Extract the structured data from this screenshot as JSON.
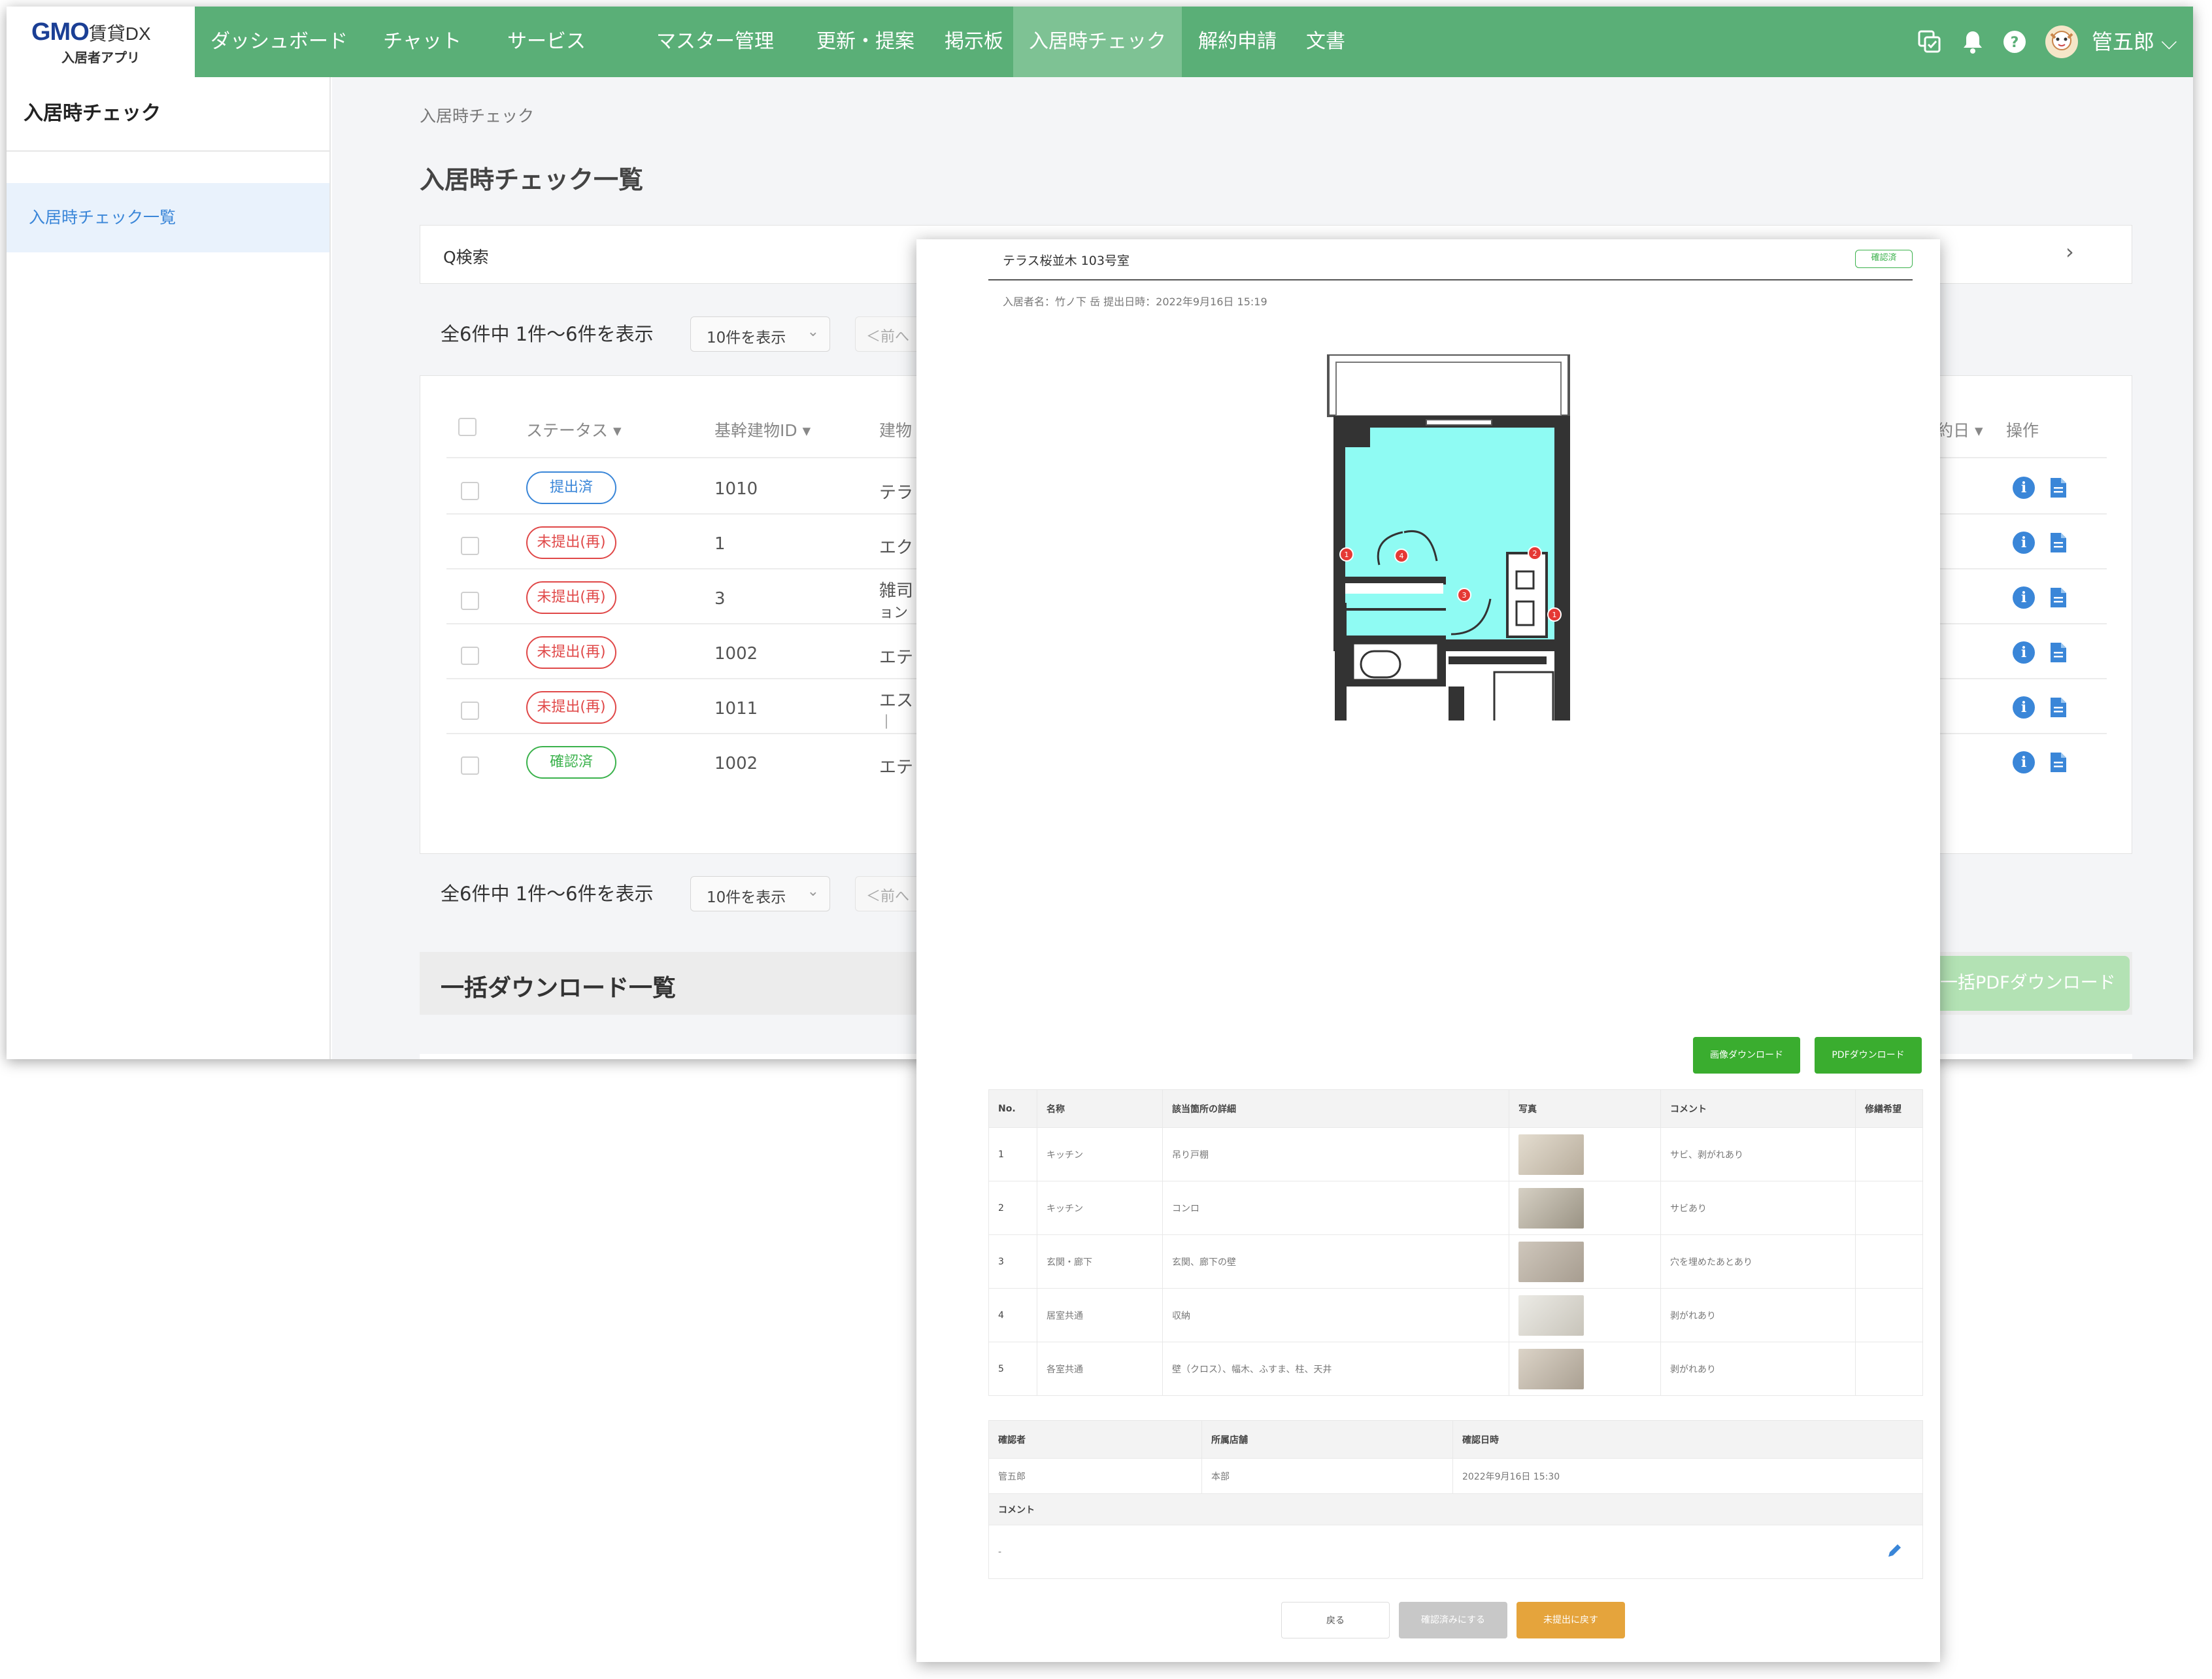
{
  "header": {
    "logo_text": "GMO",
    "logo_brand": "賃貸DX",
    "logo_sub": "入居者アプリ",
    "nav": [
      "ダッシュボード",
      "チャット",
      "サービス",
      "マスター管理",
      "更新・提案",
      "掲示板",
      "入居時チェック",
      "解約申請",
      "文書"
    ],
    "active_nav": "入居時チェック",
    "icons": [
      "copy-check-icon",
      "bell-icon",
      "help-icon"
    ],
    "user_name": "管五郎",
    "user_chevron": "⌵"
  },
  "sidebar": {
    "title": "入居時チェック",
    "items": [
      {
        "label": "入居時チェック一覧",
        "selected": true
      }
    ]
  },
  "main": {
    "breadcrumb": "入居時チェック",
    "page_title": "入居時チェック一覧",
    "search_label": "Q検索",
    "search_chevron": "›",
    "pagination": {
      "summary": "全6件中 1件〜6件を表示",
      "per_page": "10件を表示",
      "prev": "＜前へ"
    },
    "table": {
      "headers": {
        "status": "ステータス ▾",
        "building_id": "基幹建物ID ▾",
        "building": "建物",
        "date": "約日 ▾",
        "actions": "操作"
      },
      "rows": [
        {
          "status": "提出済",
          "tone": "blue",
          "building_id": "1010",
          "building": "テラ",
          "building2": ""
        },
        {
          "status": "未提出(再)",
          "tone": "red",
          "building_id": "1",
          "building": "エク",
          "building2": ""
        },
        {
          "status": "未提出(再)",
          "tone": "red",
          "building_id": "3",
          "building": "雑司",
          "building2": "ョン"
        },
        {
          "status": "未提出(再)",
          "tone": "red",
          "building_id": "1002",
          "building": "エテ",
          "building2": ""
        },
        {
          "status": "未提出(再)",
          "tone": "red",
          "building_id": "1011",
          "building": "エス",
          "building2": "｜"
        },
        {
          "status": "確認済",
          "tone": "green",
          "building_id": "1002",
          "building": "エテ",
          "building2": ""
        }
      ]
    },
    "bulk_title": "一括ダウンロード一覧",
    "bulk_button": "一括PDFダウンロード"
  },
  "modal": {
    "title": "テラス桜並木 103号室",
    "badge": "確認済",
    "meta": "入居者名：竹ノ下 岳 提出日時：2022年9月16日 15:19",
    "image_download": "画像ダウンロード",
    "pdf_download": "PDFダウンロード",
    "table_headers": [
      "No.",
      "名称",
      "該当箇所の詳細",
      "写真",
      "コメント",
      "修繕希望"
    ],
    "items": [
      {
        "no": "1",
        "name": "キッチン",
        "detail": "吊り戸棚",
        "comment": "サビ、剥がれあり",
        "repair": ""
      },
      {
        "no": "2",
        "name": "キッチン",
        "detail": "コンロ",
        "comment": "サビあり",
        "repair": ""
      },
      {
        "no": "3",
        "name": "玄関・廊下",
        "detail": "玄関、廊下の壁",
        "comment": "穴を埋めたあとあり",
        "repair": ""
      },
      {
        "no": "4",
        "name": "居室共通",
        "detail": "収納",
        "comment": "剥がれあり",
        "repair": ""
      },
      {
        "no": "5",
        "name": "各室共通",
        "detail": "壁（クロス）、幅木、ふすま、柱、天井",
        "comment": "剥がれあり",
        "repair": ""
      }
    ],
    "confirm_headers": [
      "確認者",
      "所属店舗",
      "確認日時"
    ],
    "confirm_values": [
      "管五郎",
      "本部",
      "2022年9月16日 15:30"
    ],
    "comment_label": "コメント",
    "comment_value": "-",
    "buttons": {
      "back": "戻る",
      "confirm": "確認済みにする",
      "revert": "未提出に戻す"
    },
    "colors": {
      "room_fill": "#8ffbf3",
      "marker": "#e53935",
      "download_button": "#3aad2f",
      "revert_button": "#e5a43c"
    }
  }
}
